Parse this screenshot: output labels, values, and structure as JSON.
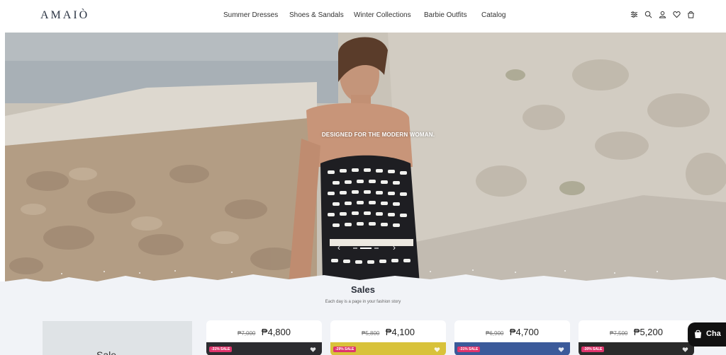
{
  "brand": {
    "logo": "AMAIÒ"
  },
  "nav": {
    "items": [
      "Summer Dresses",
      "Shoes & Sandals",
      "Winter Collections",
      "Barbie Outfits",
      "Catalog"
    ]
  },
  "header_icons": [
    "filter-icon",
    "search-icon",
    "account-icon",
    "wishlist-icon",
    "cart-icon"
  ],
  "hero": {
    "tagline": "DESIGNED FOR THE MODERN WOMAN.",
    "prev_arrow": "‹",
    "next_arrow": "›",
    "slide_count": 3,
    "active_slide": 1
  },
  "sales": {
    "title": "Sales",
    "subtitle": "Each day is a page in your fashion story",
    "promo_word": "Sale",
    "products": [
      {
        "old_price": "₱7,000",
        "new_price": "₱4,800",
        "badge": "-31% SALE",
        "thumb_color": "#2c2c30"
      },
      {
        "old_price": "₱5,800",
        "new_price": "₱4,100",
        "badge": "-29% SALE",
        "thumb_color": "#d8c23a"
      },
      {
        "old_price": "₱6,900",
        "new_price": "₱4,700",
        "badge": "-31% SALE",
        "thumb_color": "#3b5a9a"
      },
      {
        "old_price": "₱7,500",
        "new_price": "₱5,200",
        "badge": "-30% SALE",
        "thumb_color": "#2a2a2a"
      }
    ]
  },
  "chat": {
    "label": "Cha"
  },
  "colors": {
    "accent": "#2a3342",
    "badge": "#e0346c",
    "section_bg": "#f1f3f7"
  }
}
